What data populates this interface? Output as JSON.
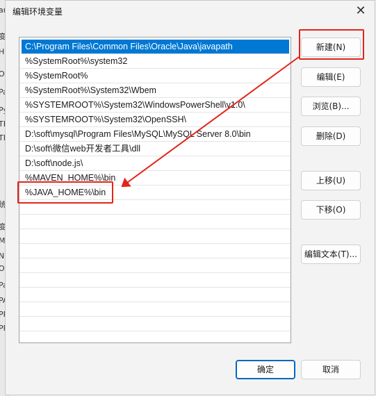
{
  "background_window": {
    "side_letters": [
      "ar",
      "变",
      "H",
      "Or",
      "Pa",
      "Py",
      "TE",
      "TM",
      "统",
      "变",
      "M",
      "NI",
      "O",
      "Pa",
      "PA",
      "PR",
      "PR"
    ]
  },
  "dialog": {
    "title": "编辑环境变量",
    "close_glyph": "✕"
  },
  "path_list": {
    "selected_index": 0,
    "items": [
      "C:\\Program Files\\Common Files\\Oracle\\Java\\javapath",
      "%SystemRoot%\\system32",
      "%SystemRoot%",
      "%SystemRoot%\\System32\\Wbem",
      "%SYSTEMROOT%\\System32\\WindowsPowerShell\\v1.0\\",
      "%SYSTEMROOT%\\System32\\OpenSSH\\",
      "D:\\soft\\mysql\\Program Files\\MySQL\\MySQL Server 8.0\\bin",
      "D:\\soft\\微信web开发者工具\\dll",
      "D:\\soft\\node.js\\",
      "%MAVEN_HOME%\\bin",
      "%JAVA_HOME%\\bin"
    ]
  },
  "buttons": {
    "new": "新建(N)",
    "edit": "编辑(E)",
    "browse": "浏览(B)...",
    "delete": "删除(D)",
    "move_up": "上移(U)",
    "move_down": "下移(O)",
    "edit_text": "编辑文本(T)...",
    "ok": "确定",
    "cancel": "取消"
  },
  "annotation": {
    "highlight_color": "#e3241b"
  },
  "colors": {
    "selection": "#0078d4",
    "primary_border": "#0067c0"
  }
}
